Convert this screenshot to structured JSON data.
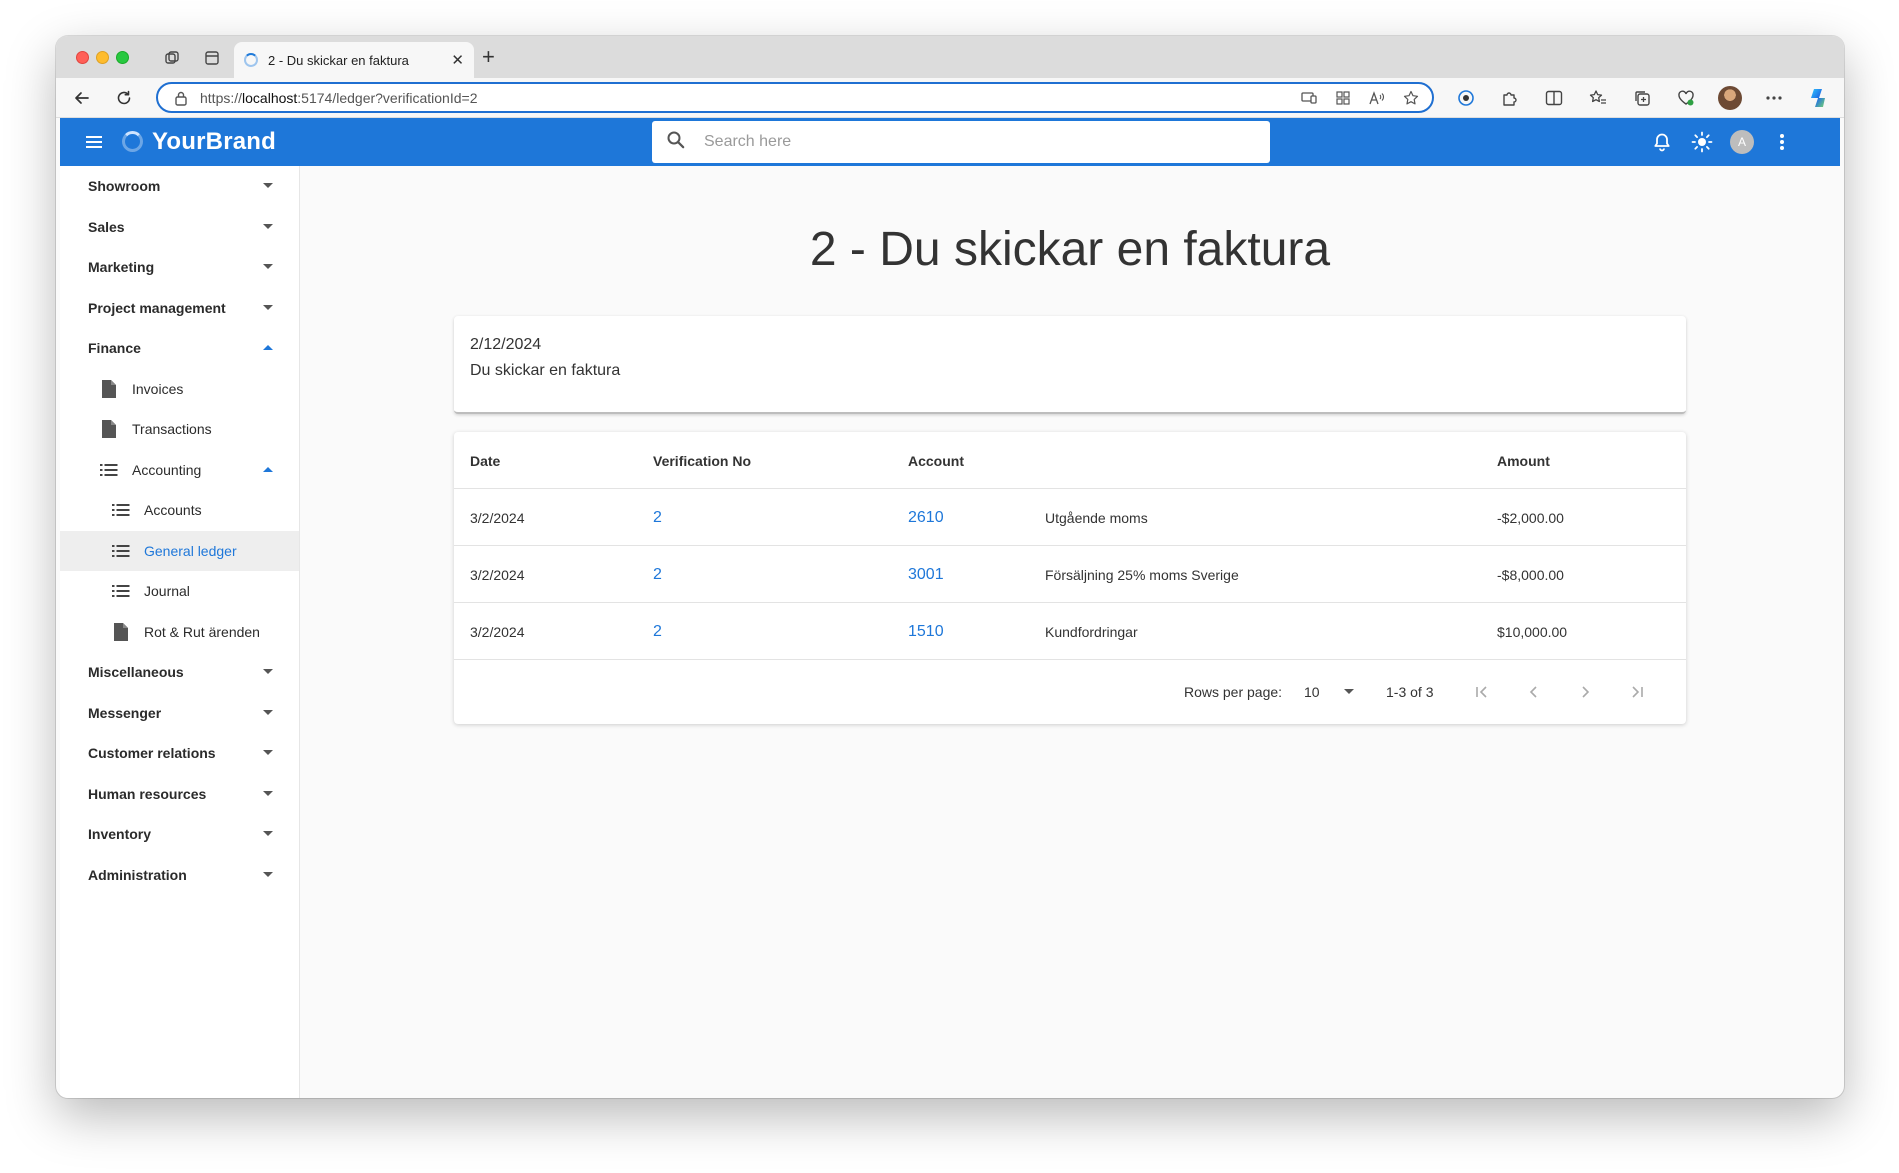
{
  "browser": {
    "tab_title": "2 - Du skickar en faktura",
    "url_prefix": "https://",
    "url_host": "localhost",
    "url_rest": ":5174/ledger?verificationId=2"
  },
  "appbar": {
    "brand": "YourBrand",
    "search_placeholder": "Search here",
    "avatar_letter": "A"
  },
  "sidebar": {
    "items": [
      {
        "label": "Showroom"
      },
      {
        "label": "Sales"
      },
      {
        "label": "Marketing"
      },
      {
        "label": "Project management"
      },
      {
        "label": "Finance"
      },
      {
        "label": "Invoices"
      },
      {
        "label": "Transactions"
      },
      {
        "label": "Accounting"
      },
      {
        "label": "Accounts"
      },
      {
        "label": "General ledger"
      },
      {
        "label": "Journal"
      },
      {
        "label": "Rot & Rut ärenden"
      },
      {
        "label": "Miscellaneous"
      },
      {
        "label": "Messenger"
      },
      {
        "label": "Customer relations"
      },
      {
        "label": "Human resources"
      },
      {
        "label": "Inventory"
      },
      {
        "label": "Administration"
      }
    ]
  },
  "page": {
    "title": "2 - Du skickar en faktura",
    "date": "2/12/2024",
    "description": "Du skickar en faktura"
  },
  "table": {
    "headers": {
      "date": "Date",
      "verification": "Verification No",
      "account": "Account",
      "amount": "Amount"
    },
    "rows": [
      {
        "date": "3/2/2024",
        "verification": "2",
        "account": "2610",
        "account_name": "Utgående moms",
        "amount": "-$2,000.00"
      },
      {
        "date": "3/2/2024",
        "verification": "2",
        "account": "3001",
        "account_name": "Försäljning 25% moms Sverige",
        "amount": "-$8,000.00"
      },
      {
        "date": "3/2/2024",
        "verification": "2",
        "account": "1510",
        "account_name": "Kundfordringar",
        "amount": "$10,000.00"
      }
    ],
    "pagination": {
      "rows_per_page_label": "Rows per page:",
      "rows_per_page": "10",
      "range": "1-3 of 3"
    }
  },
  "colors": {
    "primary": "#1e77d9",
    "background": "#fafafa"
  }
}
